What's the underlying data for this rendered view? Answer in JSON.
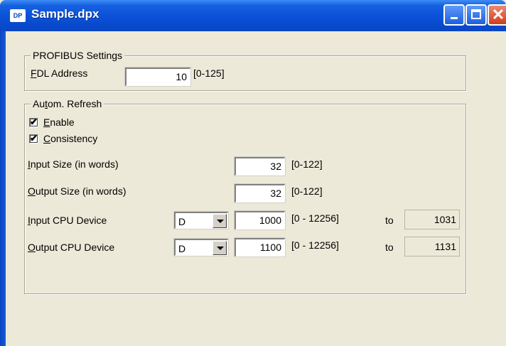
{
  "window": {
    "title": "Sample.dpx",
    "icon_label": "DP"
  },
  "profibus": {
    "group_title": "PROFIBUS Settings",
    "fdl_label_mnemonic": "F",
    "fdl_label_rest": "DL Address",
    "fdl_value": "10",
    "fdl_range": "[0-125]"
  },
  "refresh": {
    "group_title_pre": "Au",
    "group_title_mnemonic": "t",
    "group_title_post": "om. Refresh",
    "enable": {
      "mnemonic": "E",
      "rest": "nable",
      "checked": true
    },
    "consistency": {
      "mnemonic": "C",
      "rest": "onsistency",
      "checked": true
    },
    "input_size": {
      "mnemonic": "I",
      "rest": "nput Size (in words)",
      "value": "32",
      "range": "[0-122]"
    },
    "output_size": {
      "mnemonic": "O",
      "rest": "utput Size (in words)",
      "value": "32",
      "range": "[0-122]"
    },
    "input_cpu": {
      "mnemonic": "I",
      "rest": "nput CPU Device",
      "device": "D",
      "value": "1000",
      "range": "[0 - 12256]",
      "to_label": "to",
      "end": "1031"
    },
    "output_cpu": {
      "mnemonic": "O",
      "rest": "utput CPU Device",
      "device": "D",
      "value": "1100",
      "range": "[0 - 12256]",
      "to_label": "to",
      "end": "1131"
    },
    "check_glyph": "✔"
  }
}
